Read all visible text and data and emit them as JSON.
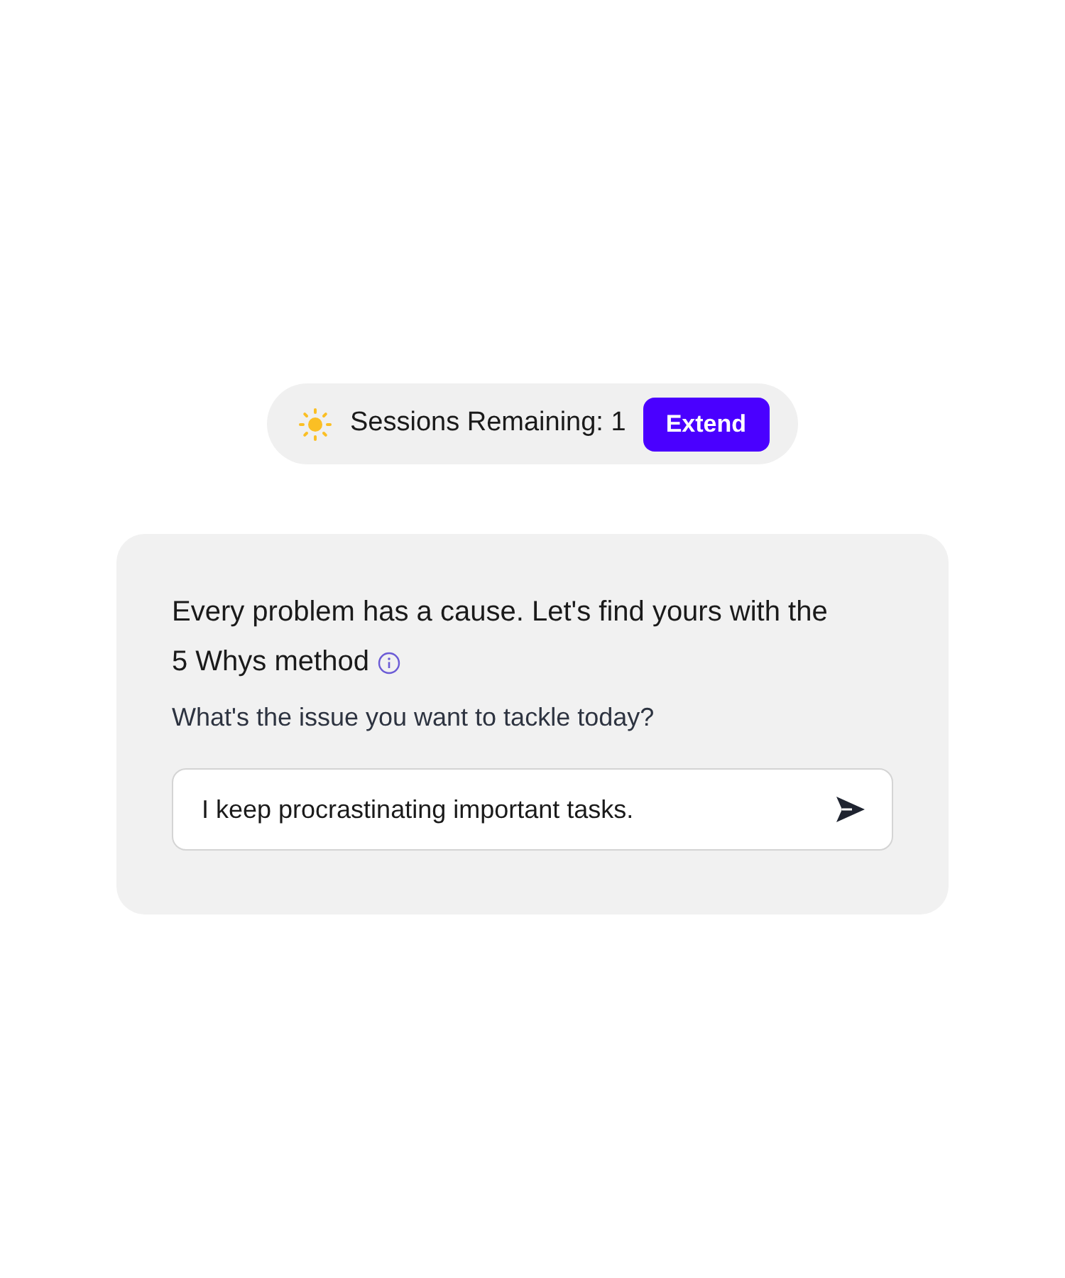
{
  "sessions_bar": {
    "label": "Sessions Remaining: 1",
    "button": "Extend"
  },
  "card": {
    "headline_lines": [
      "Every problem has a cause. Let's find yours with the",
      "5 Whys method"
    ],
    "prompt": "What's the issue you want to tackle today?",
    "input": {
      "value": "I keep procrastinating important tasks."
    }
  }
}
